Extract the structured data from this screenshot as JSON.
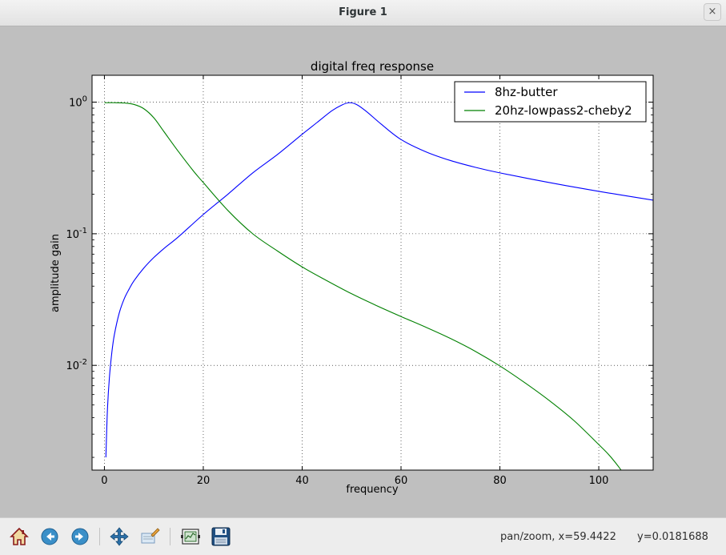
{
  "window": {
    "title": "Figure 1",
    "close_glyph": "×"
  },
  "toolbar": {
    "buttons": [
      {
        "name": "home-button",
        "icon": "home-icon"
      },
      {
        "name": "back-button",
        "icon": "back-arrow-icon"
      },
      {
        "name": "forward-button",
        "icon": "forward-arrow-icon"
      },
      {
        "name": "pan-button",
        "icon": "pan-move-icon"
      },
      {
        "name": "zoom-button",
        "icon": "zoom-rect-icon"
      },
      {
        "name": "subplots-button",
        "icon": "subplots-config-icon"
      },
      {
        "name": "save-button",
        "icon": "save-floppy-icon"
      }
    ],
    "status_mode": "pan/zoom, x=59.4422",
    "status_y": "y=0.0181688"
  },
  "chart_data": {
    "type": "line",
    "title": "digital freq response",
    "xlabel": "frequency",
    "ylabel": "amplitude gain",
    "xlim": [
      -2.5,
      111
    ],
    "ylim": [
      0.0016,
      1.6
    ],
    "yscale": "log",
    "grid": true,
    "legend_position": "upper right",
    "x_ticks": [
      0,
      20,
      40,
      60,
      80,
      100
    ],
    "x_tick_labels": [
      "0",
      "20",
      "40",
      "60",
      "80",
      "100"
    ],
    "y_ticks": [
      0.01,
      0.1,
      1
    ],
    "y_tick_labels": [
      {
        "base": "10",
        "exp": "-2"
      },
      {
        "base": "10",
        "exp": "-1"
      },
      {
        "base": "10",
        "exp": "0"
      }
    ],
    "series": [
      {
        "name": "8hz-butter",
        "color": "#0000ff",
        "x": [
          0.3,
          0.6,
          1,
          1.5,
          2,
          3,
          4,
          5,
          6,
          8,
          10,
          12,
          15,
          20,
          25,
          30,
          35,
          40,
          43,
          46,
          48,
          49.5,
          51,
          53,
          56,
          60,
          65,
          70,
          75,
          80,
          90,
          100,
          111
        ],
        "y": [
          0.002,
          0.0045,
          0.008,
          0.0125,
          0.017,
          0.025,
          0.032,
          0.038,
          0.044,
          0.055,
          0.066,
          0.077,
          0.095,
          0.14,
          0.2,
          0.29,
          0.4,
          0.57,
          0.7,
          0.86,
          0.95,
          0.99,
          0.96,
          0.85,
          0.68,
          0.52,
          0.42,
          0.36,
          0.32,
          0.29,
          0.245,
          0.21,
          0.18
        ]
      },
      {
        "name": "20hz-lowpass2-cheby2",
        "color": "#008000",
        "x": [
          0,
          2,
          4,
          6,
          8,
          10,
          12,
          15,
          18,
          20,
          25,
          30,
          35,
          40,
          45,
          50,
          55,
          60,
          65,
          70,
          75,
          80,
          85,
          90,
          95,
          100,
          102,
          104,
          105
        ],
        "y": [
          0.99,
          0.99,
          0.985,
          0.96,
          0.89,
          0.76,
          0.6,
          0.42,
          0.3,
          0.245,
          0.15,
          0.1,
          0.074,
          0.056,
          0.044,
          0.035,
          0.0285,
          0.0235,
          0.0195,
          0.016,
          0.0128,
          0.0099,
          0.0074,
          0.0054,
          0.0038,
          0.0025,
          0.0021,
          0.0017,
          0.0015
        ]
      }
    ]
  }
}
